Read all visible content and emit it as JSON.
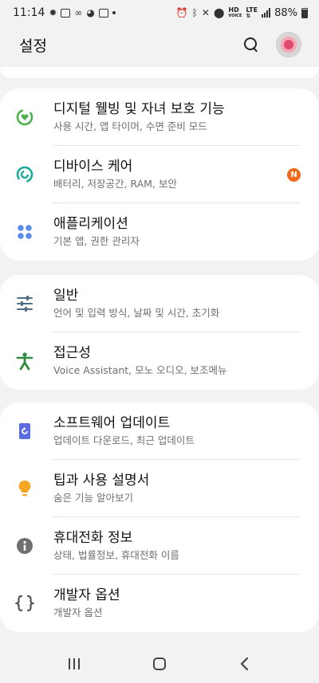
{
  "status_bar": {
    "time": "11:14",
    "network_label": "HD",
    "network_sub": "VOICE",
    "lte_label": "LTE",
    "battery_percent": "88%"
  },
  "header": {
    "title": "설정"
  },
  "groups": [
    {
      "items": [
        {
          "title": "디지털 웰빙 및 자녀 보호 기능",
          "subtitle": "사용 시간, 앱 타이머, 수면 준비 모드",
          "icon": "digital-wellbeing-icon",
          "color": "#4caf50"
        },
        {
          "title": "디바이스 케어",
          "subtitle": "배터리, 저장공간, RAM, 보안",
          "icon": "device-care-icon",
          "color": "#1aa99a",
          "badge": "N",
          "badge_color": "#f06a1c"
        },
        {
          "title": "애플리케이션",
          "subtitle": "기본 앱, 권한 관리자",
          "icon": "apps-icon",
          "color": "#5b8ee6"
        }
      ]
    },
    {
      "items": [
        {
          "title": "일반",
          "subtitle": "언어 및 입력 방식, 날짜 및 시간, 초기화",
          "icon": "general-sliders-icon",
          "color": "#4f6e86"
        },
        {
          "title": "접근성",
          "subtitle": "Voice Assistant, 모노 오디오, 보조메뉴",
          "icon": "accessibility-icon",
          "color": "#2e8b3e"
        }
      ]
    },
    {
      "items": [
        {
          "title": "소프트웨어 업데이트",
          "subtitle": "업데이트 다운로드, 최근 업데이트",
          "icon": "software-update-icon",
          "color": "#5b6de0"
        },
        {
          "title": "팁과 사용 설명서",
          "subtitle": "숨은 기능 알아보기",
          "icon": "lightbulb-icon",
          "color": "#f5a623"
        },
        {
          "title": "휴대전화 정보",
          "subtitle": "상태, 법률정보, 휴대전화 이름",
          "icon": "info-icon",
          "color": "#707070"
        },
        {
          "title": "개발자 옵션",
          "subtitle": "개발자 옵션",
          "icon": "developer-braces-icon",
          "color": "#555555"
        }
      ]
    }
  ]
}
